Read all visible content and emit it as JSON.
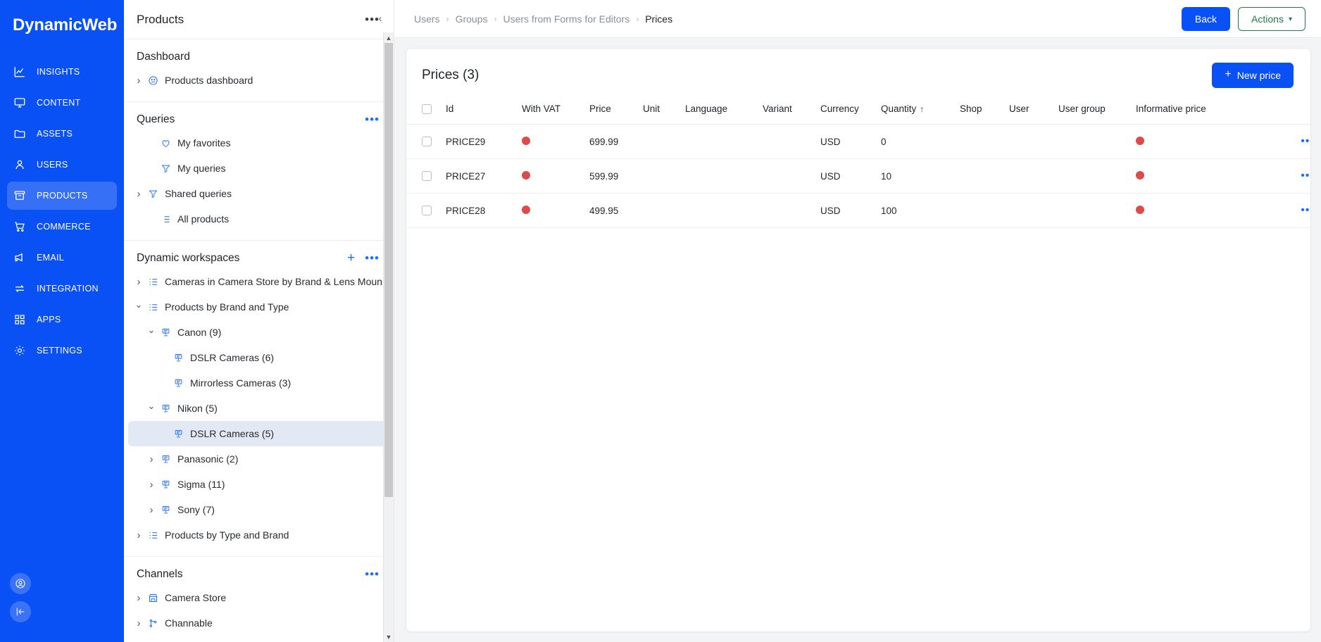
{
  "brand": {
    "name": "DynamicWeb"
  },
  "primary_nav": {
    "items": [
      {
        "label": "INSIGHTS",
        "icon": "chart-line-icon",
        "active": false
      },
      {
        "label": "CONTENT",
        "icon": "monitor-icon",
        "active": false
      },
      {
        "label": "ASSETS",
        "icon": "folder-icon",
        "active": false
      },
      {
        "label": "USERS",
        "icon": "user-icon",
        "active": false
      },
      {
        "label": "PRODUCTS",
        "icon": "archive-box-icon",
        "active": true
      },
      {
        "label": "COMMERCE",
        "icon": "shopping-cart-icon",
        "active": false
      },
      {
        "label": "EMAIL",
        "icon": "megaphone-icon",
        "active": false
      },
      {
        "label": "INTEGRATION",
        "icon": "arrows-swap-icon",
        "active": false
      },
      {
        "label": "APPS",
        "icon": "grid-squares-icon",
        "active": false
      },
      {
        "label": "SETTINGS",
        "icon": "gear-icon",
        "active": false
      }
    ],
    "bottom": [
      {
        "icon": "account-circle-icon"
      },
      {
        "icon": "collapse-left-icon"
      }
    ]
  },
  "panel": {
    "title": "Products",
    "overflow_label": "•••",
    "collapse_icon": "chevron-left-icon",
    "groups": [
      {
        "title": "Dashboard",
        "has_add": false,
        "has_overflow": false,
        "items": [
          {
            "label": "Products dashboard",
            "caret": "right",
            "icon": "dashboard-face-icon",
            "indent": 0,
            "selected": false
          }
        ]
      },
      {
        "title": "Queries",
        "has_add": false,
        "has_overflow": true,
        "items": [
          {
            "label": "My favorites",
            "caret": "none",
            "icon": "heart-icon",
            "indent": 1,
            "selected": false
          },
          {
            "label": "My queries",
            "caret": "none",
            "icon": "funnel-icon",
            "indent": 1,
            "selected": false
          },
          {
            "label": "Shared queries",
            "caret": "right",
            "icon": "funnel-icon",
            "indent": 0,
            "selected": false
          },
          {
            "label": "All products",
            "caret": "none",
            "icon": "list-icon",
            "indent": 1,
            "selected": false
          }
        ]
      },
      {
        "title": "Dynamic workspaces",
        "has_add": true,
        "has_overflow": true,
        "items": [
          {
            "label": "Cameras in Camera Store by Brand & Lens Mount",
            "caret": "right",
            "icon": "workspace-list-icon",
            "indent": 0,
            "selected": false
          },
          {
            "label": "Products by Brand and Type",
            "caret": "down",
            "icon": "workspace-list-icon",
            "indent": 0,
            "selected": false
          },
          {
            "label": "Canon (9)",
            "caret": "down",
            "icon": "node-icon",
            "indent": 1,
            "selected": false
          },
          {
            "label": "DSLR Cameras (6)",
            "caret": "none",
            "icon": "node-icon",
            "indent": 2,
            "selected": false
          },
          {
            "label": "Mirrorless Cameras (3)",
            "caret": "none",
            "icon": "node-icon",
            "indent": 2,
            "selected": false
          },
          {
            "label": "Nikon (5)",
            "caret": "down",
            "icon": "node-icon",
            "indent": 1,
            "selected": false
          },
          {
            "label": "DSLR Cameras (5)",
            "caret": "none",
            "icon": "node-icon",
            "indent": 2,
            "selected": true
          },
          {
            "label": "Panasonic (2)",
            "caret": "right",
            "icon": "node-icon",
            "indent": 1,
            "selected": false
          },
          {
            "label": "Sigma (11)",
            "caret": "right",
            "icon": "node-icon",
            "indent": 1,
            "selected": false
          },
          {
            "label": "Sony (7)",
            "caret": "right",
            "icon": "node-icon",
            "indent": 1,
            "selected": false
          },
          {
            "label": "Products by Type and Brand",
            "caret": "right",
            "icon": "workspace-list-icon",
            "indent": 0,
            "selected": false
          }
        ]
      },
      {
        "title": "Channels",
        "has_add": false,
        "has_overflow": true,
        "items": [
          {
            "label": "Camera Store",
            "caret": "right",
            "icon": "storefront-icon",
            "indent": 0,
            "selected": false
          },
          {
            "label": "Channable",
            "caret": "right",
            "icon": "branch-icon",
            "indent": 0,
            "selected": false
          }
        ]
      }
    ]
  },
  "topbar": {
    "breadcrumb": [
      "Users",
      "Groups",
      "Users from Forms for Editors",
      "Prices"
    ],
    "separator": "›",
    "back_label": "Back",
    "actions_label": "Actions",
    "actions_caret": "chevron-down-icon"
  },
  "content": {
    "title": "Prices (3)",
    "new_button": {
      "label": "New price",
      "icon": "plus-icon"
    },
    "table": {
      "columns": [
        {
          "key": "id",
          "label": "Id"
        },
        {
          "key": "with_vat",
          "label": "With VAT"
        },
        {
          "key": "price",
          "label": "Price"
        },
        {
          "key": "unit",
          "label": "Unit"
        },
        {
          "key": "language",
          "label": "Language"
        },
        {
          "key": "variant",
          "label": "Variant"
        },
        {
          "key": "currency",
          "label": "Currency"
        },
        {
          "key": "quantity",
          "label": "Quantity",
          "sorted": "asc",
          "sort_glyph": "↑"
        },
        {
          "key": "shop",
          "label": "Shop"
        },
        {
          "key": "user",
          "label": "User"
        },
        {
          "key": "user_group",
          "label": "User group"
        },
        {
          "key": "informative_price",
          "label": "Informative price"
        }
      ],
      "rows": [
        {
          "id": "PRICE29",
          "with_vat": false,
          "price": "699.99",
          "unit": "",
          "language": "",
          "variant": "",
          "currency": "USD",
          "quantity": "0",
          "shop": "",
          "user": "",
          "user_group": "",
          "informative_price": false,
          "selected": false,
          "menu": "•••"
        },
        {
          "id": "PRICE27",
          "with_vat": false,
          "price": "599.99",
          "unit": "",
          "language": "",
          "variant": "",
          "currency": "USD",
          "quantity": "10",
          "shop": "",
          "user": "",
          "user_group": "",
          "informative_price": false,
          "selected": false,
          "menu": "•••"
        },
        {
          "id": "PRICE28",
          "with_vat": false,
          "price": "499.95",
          "unit": "",
          "language": "",
          "variant": "",
          "currency": "USD",
          "quantity": "100",
          "shop": "",
          "user": "",
          "user_group": "",
          "informative_price": false,
          "selected": false,
          "menu": "•••"
        }
      ]
    }
  },
  "colors": {
    "brand_blue": "#0a51f5",
    "accent_blue": "#1a6dff",
    "status_red": "#dc4a4a",
    "actions_green": "#1f7a4d",
    "selected_row": "#e3e9f4"
  }
}
